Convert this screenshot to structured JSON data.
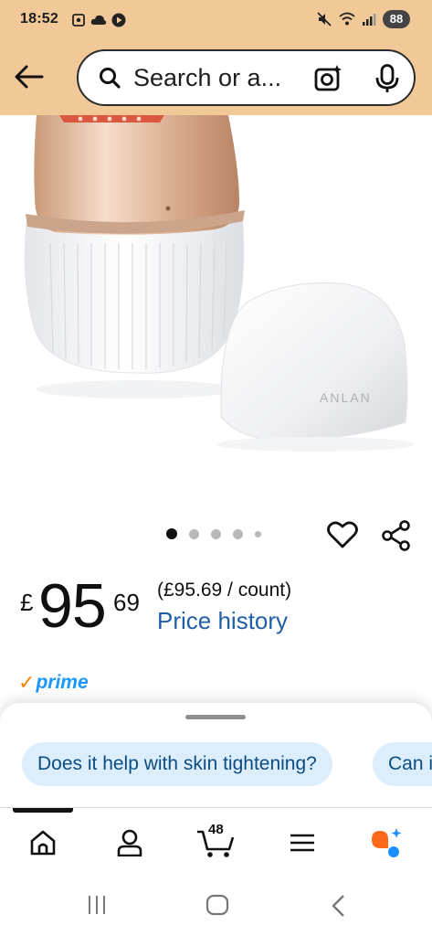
{
  "status_bar": {
    "time": "18:52",
    "battery": "88"
  },
  "header": {
    "search_placeholder": "Search or a...",
    "accent_color": "#f1c898"
  },
  "product_image": {
    "brand_text": "ANLAN",
    "carousel_pages": 5,
    "carousel_active": 1
  },
  "price": {
    "currency": "£",
    "whole": "95",
    "fraction": "69",
    "unit_price": "(£95.69 / count)",
    "price_history_link": "Price history"
  },
  "prime": {
    "check": "✓",
    "label": "prime"
  },
  "suggestions": [
    "Does it help with skin tightening?",
    "Can i"
  ],
  "tab_bar": {
    "cart_count": "48"
  },
  "icons": [
    "back-arrow-icon",
    "search-icon",
    "camera-icon",
    "mic-icon",
    "heart-icon",
    "share-icon",
    "home-icon",
    "account-icon",
    "cart-icon",
    "menu-icon",
    "rufus-icon",
    "recents-icon",
    "home-nav-icon",
    "back-nav-icon"
  ]
}
